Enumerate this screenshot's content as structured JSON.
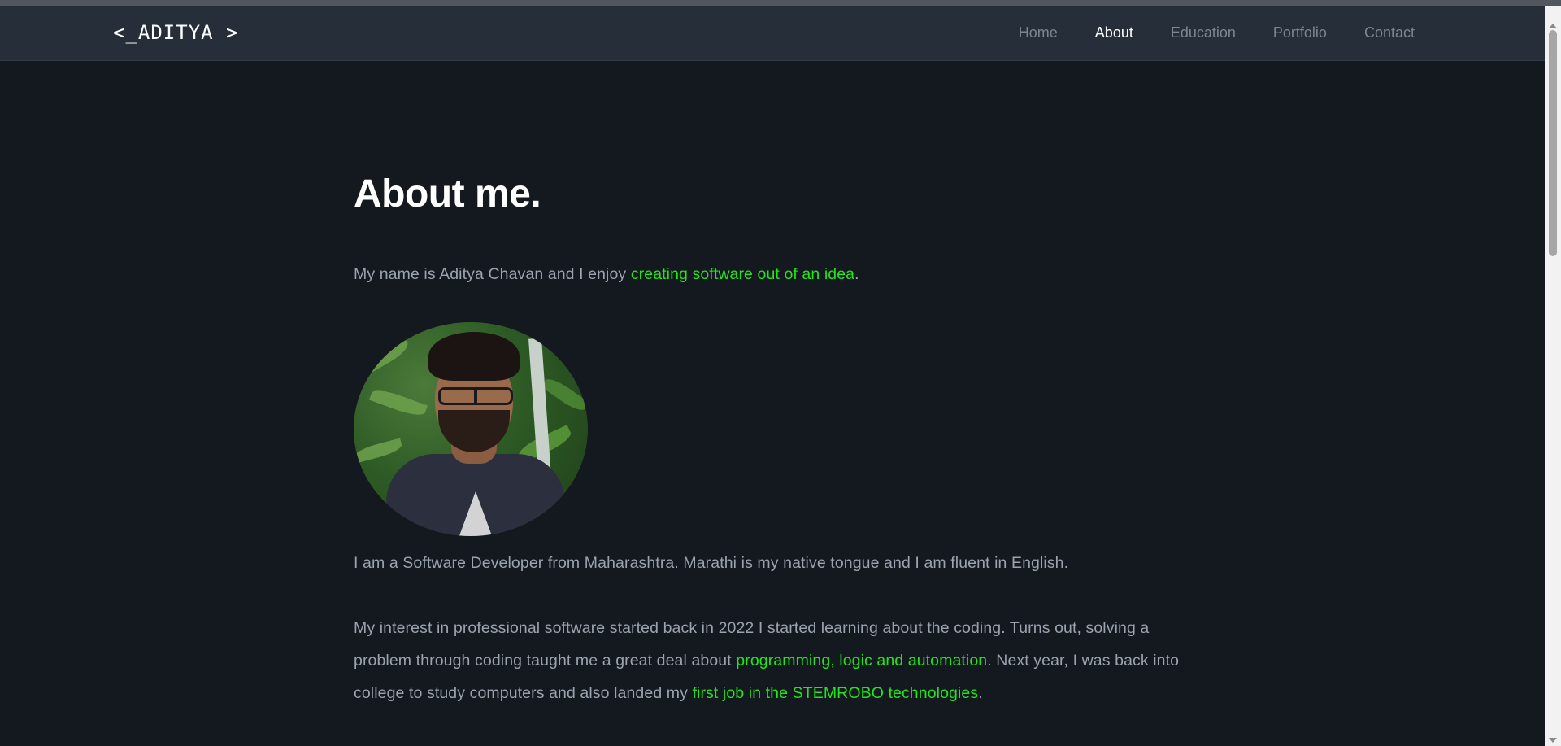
{
  "nav": {
    "logo": "<_ADITYA >",
    "links": [
      "Home",
      "About",
      "Education",
      "Portfolio",
      "Contact"
    ],
    "active": "About"
  },
  "about": {
    "title": "About me.",
    "intro_prefix": "My name is Aditya Chavan and I enjoy ",
    "intro_highlight": "creating software out of an idea",
    "intro_suffix": ".",
    "photo_alt": "Aditya Chavan portrait",
    "bio1": "I am a Software Developer from Maharashtra. Marathi is my native tongue and I am fluent in English.",
    "bio2_part1": "My interest in professional software started back in 2022 I started learning about the coding. Turns out, solving a problem through coding taught me a great deal about ",
    "bio2_highlight1": "programming, logic and automation",
    "bio2_part2": ". Next year, I was back into college to study computers and also landed my ",
    "bio2_highlight2": "first job in the STEMROBO technologies",
    "bio2_part3": "."
  },
  "colors": {
    "background": "#14181f",
    "navbar": "#262f39",
    "highlight": "#22e51b",
    "text": "#9ba3ae",
    "heading": "#ffffff"
  }
}
